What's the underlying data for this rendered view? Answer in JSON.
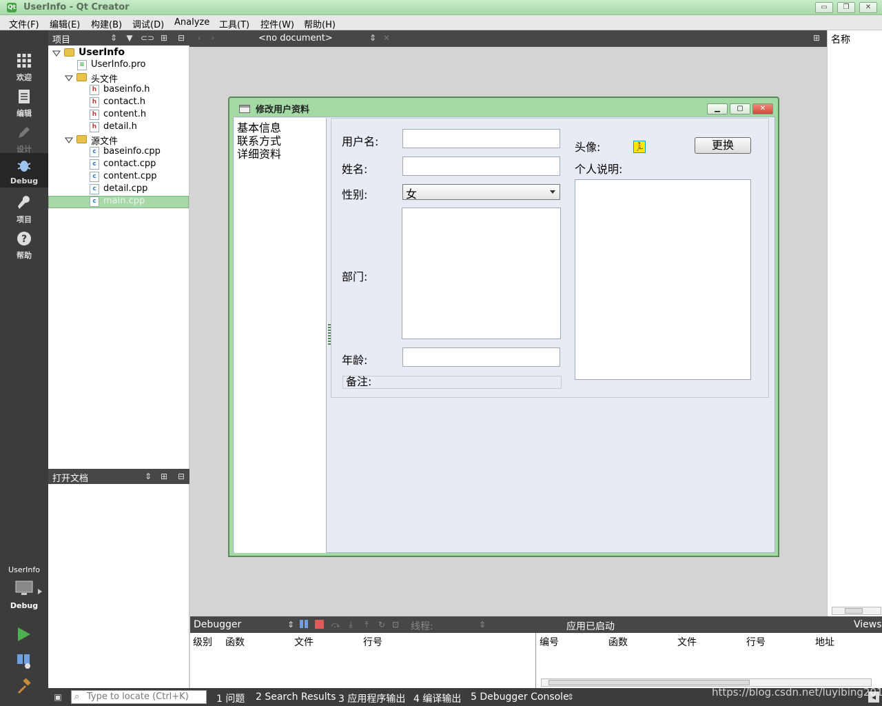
{
  "window": {
    "title": "UserInfo - Qt Creator",
    "buttons": {
      "minimize": "▭",
      "restore": "❐",
      "close": "✕"
    }
  },
  "menubar": {
    "items": [
      "文件(F)",
      "编辑(E)",
      "构建(B)",
      "调试(D)",
      "Analyze",
      "工具(T)",
      "控件(W)",
      "帮助(H)"
    ]
  },
  "modes": [
    {
      "label": "欢迎",
      "icon": "grid-icon"
    },
    {
      "label": "编辑",
      "icon": "document-icon"
    },
    {
      "label": "设计",
      "icon": "pencil-icon"
    },
    {
      "label": "Debug",
      "icon": "bug-icon"
    },
    {
      "label": "项目",
      "icon": "wrench-icon"
    },
    {
      "label": "帮助",
      "icon": "help-icon"
    }
  ],
  "kit": {
    "project": "UserInfo",
    "mode": "Debug"
  },
  "project_pane": {
    "title": "项目",
    "tree": {
      "root": "UserInfo",
      "pro_file": "UserInfo.pro",
      "headers_folder": "头文件",
      "headers": [
        "baseinfo.h",
        "contact.h",
        "content.h",
        "detail.h"
      ],
      "sources_folder": "源文件",
      "sources": [
        "baseinfo.cpp",
        "contact.cpp",
        "content.cpp",
        "detail.cpp",
        "main.cpp"
      ]
    },
    "selected": "main.cpp"
  },
  "open_docs_pane": {
    "title": "打开文档"
  },
  "editor_toolbar": {
    "document": "<no document>"
  },
  "right_pane": {
    "title": "名称"
  },
  "dialog": {
    "title": "修改用户资料",
    "nav_items": [
      "基本信息",
      "联系方式",
      "详细资料"
    ],
    "labels": {
      "username": "用户名:",
      "name": "姓名:",
      "gender": "性别:",
      "department": "部门:",
      "age": "年龄:",
      "remark": "备注:",
      "avatar": "头像:",
      "bio": "个人说明:"
    },
    "gender_value": "女",
    "change_button": "更换"
  },
  "debugger": {
    "selector": "Debugger",
    "thread_label": "线程:",
    "status": "应用已启动",
    "views": "Views",
    "stack_columns": [
      "级别",
      "函数",
      "文件",
      "行号"
    ],
    "thread_columns": [
      "编号",
      "函数",
      "文件",
      "行号",
      "地址"
    ]
  },
  "statusbar": {
    "locator_placeholder": "Type to locate (Ctrl+K)",
    "tabs": [
      "1  问题",
      "2  Search Results",
      "3  应用程序输出",
      "4  编译输出",
      "5  Debugger Console"
    ]
  },
  "watermark": "https://blog.csdn.net/luyibing201"
}
